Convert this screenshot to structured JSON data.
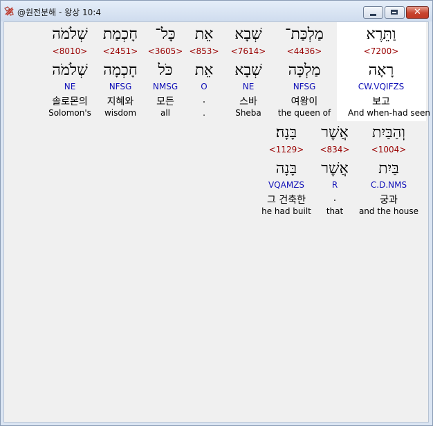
{
  "window": {
    "title": "@원전분해 - 왕상 10:4"
  },
  "row1": [
    {
      "hebrew": "וַתֵּרֶא",
      "strong": "<7200>",
      "lemma": "רָאָה",
      "parse": "CW.VQIFZS",
      "korean": "보고",
      "english": "And when-had seen"
    },
    {
      "hebrew": "מַלְכַּת־",
      "strong": "<4436>",
      "lemma": "מַלְכָּה",
      "parse": "NFSG",
      "korean": "여왕이",
      "english": "the queen of"
    },
    {
      "hebrew": "שְׁבָא",
      "strong": "<7614>",
      "lemma": "שְׁבָא",
      "parse": "NE",
      "korean": "스바",
      "english": "Sheba"
    },
    {
      "hebrew": "אֵת",
      "strong": "<853>",
      "lemma": "אֵת",
      "parse": "O",
      "korean": ".",
      "english": "."
    },
    {
      "hebrew": "כָּל־",
      "strong": "<3605>",
      "lemma": "כֹּל",
      "parse": "NMSG",
      "korean": "모든",
      "english": "all"
    },
    {
      "hebrew": "חָכְמַת",
      "strong": "<2451>",
      "lemma": "חָכְמָה",
      "parse": "NFSG",
      "korean": "지혜와",
      "english": "wisdom"
    },
    {
      "hebrew": "שְׁלֹמֹה",
      "strong": "<8010>",
      "lemma": "שְׁלֹמֹה",
      "parse": "NE",
      "korean": "솔로몬의",
      "english": "Solomon's"
    }
  ],
  "row2": [
    {
      "hebrew": "וְהַבַּיִת",
      "strong": "<1004>",
      "lemma": "בַּיִת",
      "parse": "C.D.NMS",
      "korean": "궁과",
      "english": "and the house"
    },
    {
      "hebrew": "אֲשֶׁר",
      "strong": "<834>",
      "lemma": "אֲשֶׁר",
      "parse": "R",
      "korean": ".",
      "english": "that"
    },
    {
      "hebrew": "בָּנָה׃",
      "strong": "<1129>",
      "lemma": "בָּנָה",
      "parse": "VQAMZS",
      "korean": "그 건축한",
      "english": "he had built"
    }
  ]
}
